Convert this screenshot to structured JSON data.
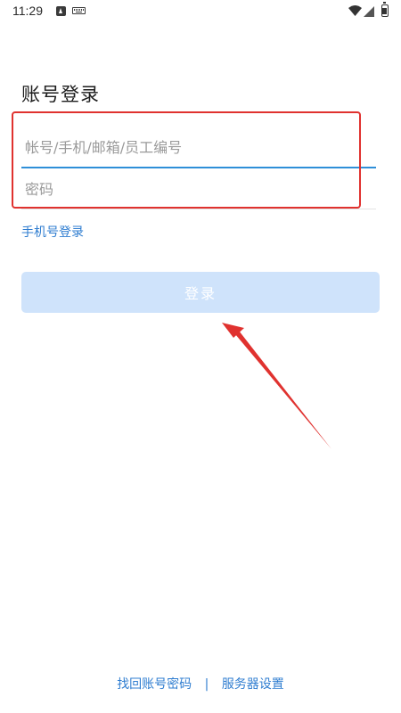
{
  "status_bar": {
    "time": "11:29",
    "icons": [
      "android-a-icon",
      "keyboard-icon",
      "wifi-icon",
      "signal-icon",
      "battery-charging-icon"
    ]
  },
  "login": {
    "title": "账号登录",
    "account_placeholder": "帐号/手机/邮箱/员工编号",
    "account_value": "",
    "password_placeholder": "密码",
    "password_value": "",
    "phone_login_label": "手机号登录",
    "login_button_label": "登录"
  },
  "footer": {
    "recover_label": "找回账号密码",
    "divider": "|",
    "server_settings_label": "服务器设置"
  },
  "colors": {
    "accent_blue": "#2f8fd8",
    "link_blue": "#2f7dd0",
    "button_disabled_bg": "#cfe3fb",
    "annotation_red": "#e0322f"
  }
}
